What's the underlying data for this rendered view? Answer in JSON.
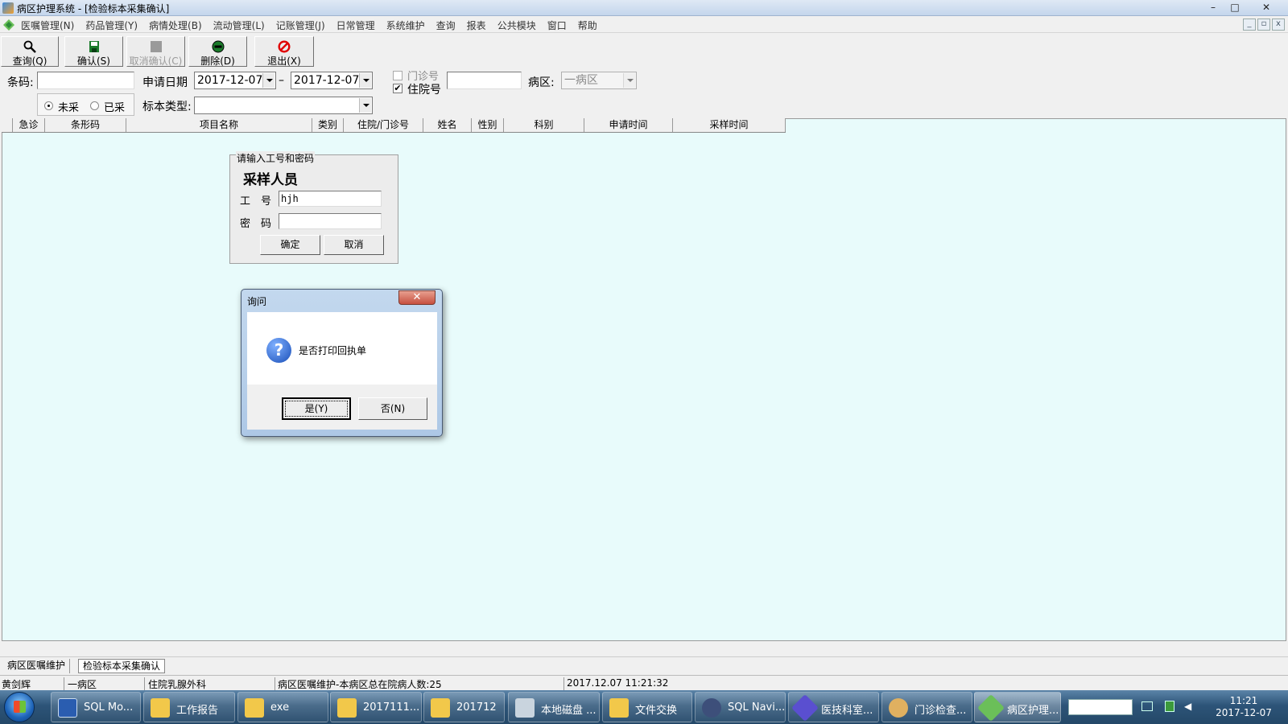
{
  "window": {
    "title": "病区护理系统 - [检验标本采集确认]",
    "min": "–",
    "max": "□",
    "close": "✕"
  },
  "menu": [
    "医嘱管理(N)",
    "药品管理(Y)",
    "病情处理(B)",
    "流动管理(L)",
    "记账管理(J)",
    "日常管理",
    "系统维护",
    "查询",
    "报表",
    "公共模块",
    "窗口",
    "帮助"
  ],
  "toolbar": {
    "query": "查询(Q)",
    "confirm": "确认(S)",
    "cancel_confirm": "取消确认(C)",
    "delete": "删除(D)",
    "exit": "退出(X)"
  },
  "filters": {
    "barcode_label": "条码:",
    "barcode_value": "",
    "apply_date_label": "申请日期",
    "date_from": "2017-12-07",
    "date_sep": "–",
    "date_to": "2017-12-07",
    "outpatient_label": "门诊号",
    "inpatient_label": "住院号",
    "inpatient_checked": "✔",
    "patient_no_value": "",
    "ward_label": "病区:",
    "ward_value": "一病区",
    "radio_uncollected": "未采",
    "radio_collected": "已采",
    "specimen_type_label": "标本类型:",
    "specimen_type_value": ""
  },
  "grid": {
    "columns": [
      "急诊",
      "条形码",
      "项目名称",
      "类别",
      "住院/门诊号",
      "姓名",
      "性别",
      "科别",
      "申请时间",
      "采样时间"
    ]
  },
  "login_panel": {
    "legend": "请输入工号和密码",
    "heading": "采样人员",
    "id_label": "工　号",
    "id_value": "hjh",
    "password_label": "密　码",
    "password_value": "",
    "ok": "确定",
    "cancel": "取消"
  },
  "dialog": {
    "title": "询问",
    "close": "✕",
    "icon": "?",
    "message": "是否打印回执单",
    "yes": "是(Y)",
    "no": "否(N)"
  },
  "tabs": [
    "病区医嘱维护",
    "检验标本采集确认"
  ],
  "status": {
    "user": "黄剑辉",
    "ward": "一病区",
    "dept": "住院乳腺外科",
    "info": "病区医嘱维护-本病区总在院病人数:25",
    "datetime": "2017.12.07 11:21:32"
  },
  "taskbar": {
    "items": [
      "SQL Mo...",
      "工作报告",
      "exe",
      "2017111...",
      "201712",
      "本地磁盘 ...",
      "文件交换",
      "SQL Navi...",
      "医技科室...",
      "门诊检查...",
      "病区护理..."
    ],
    "time": "11:21",
    "date": "2017-12-07"
  }
}
